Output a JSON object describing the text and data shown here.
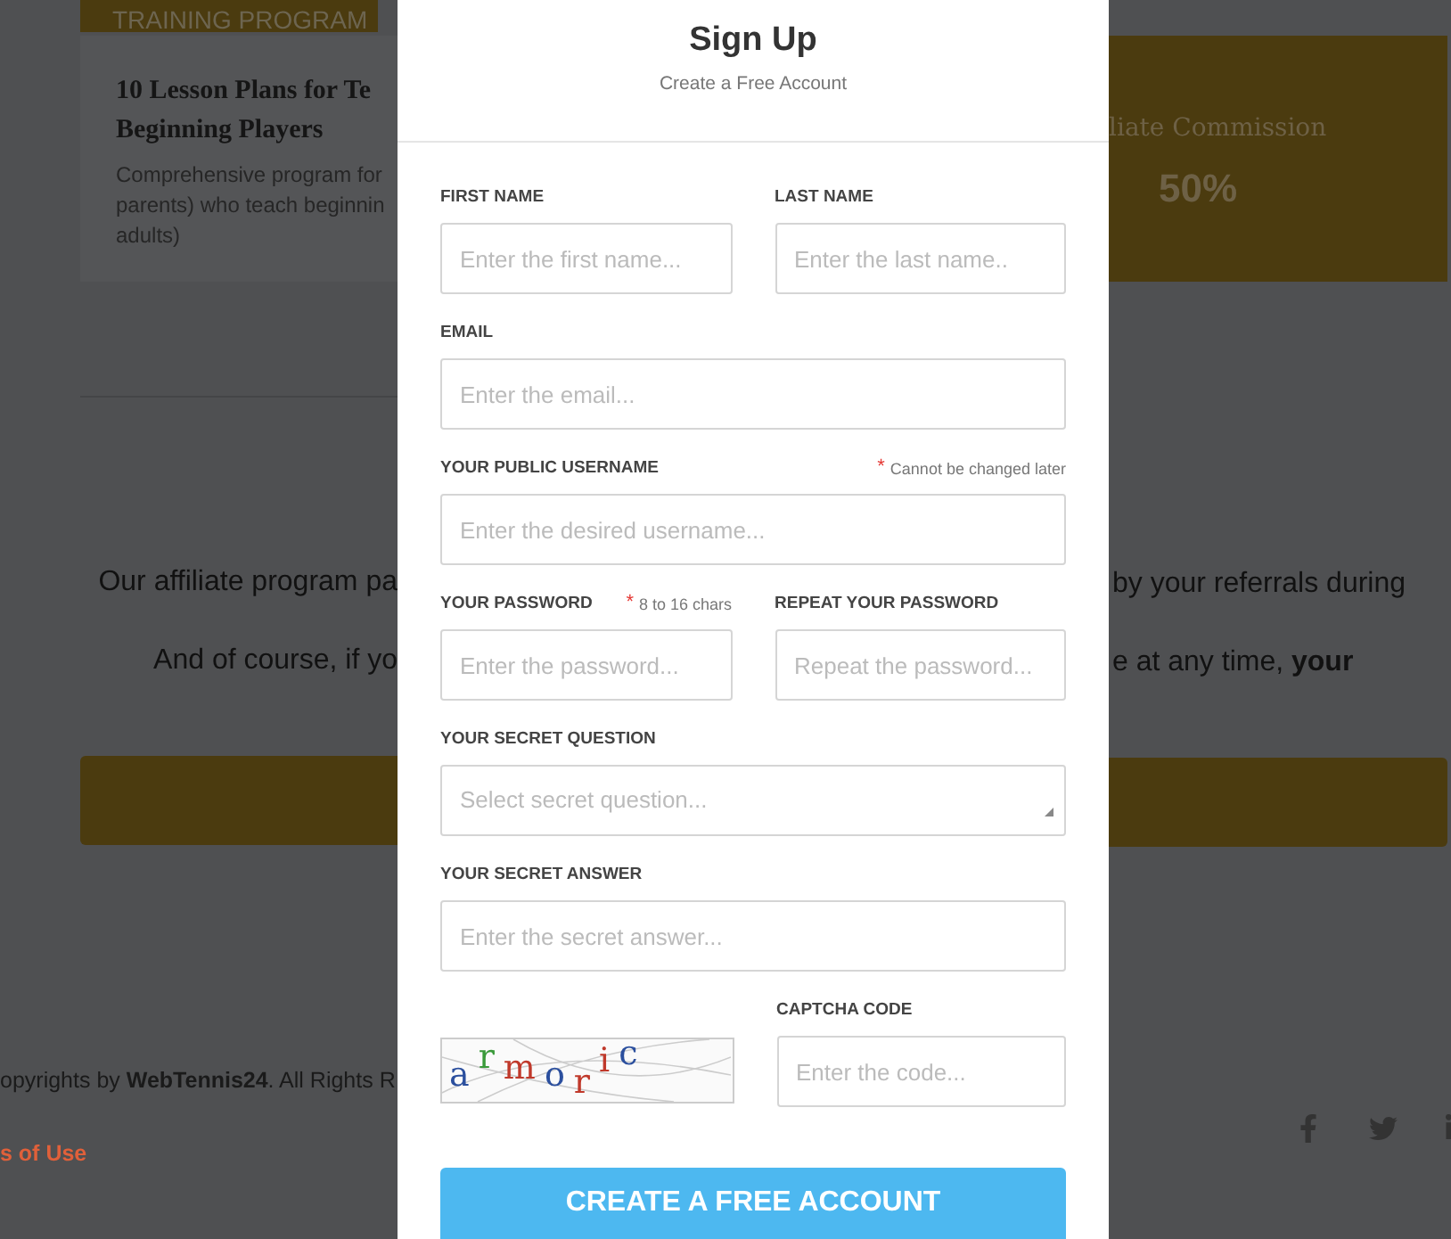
{
  "background": {
    "tag": "TRAINING PROGRAM",
    "card": {
      "title_lines": [
        "10 Lesson Plans for Te",
        "Beginning Players"
      ],
      "description_lines": [
        "Comprehensive program for",
        "parents) who teach beginnin",
        "adults)"
      ]
    },
    "commission": {
      "label": "liate Commission",
      "value": "50%"
    },
    "paragraphs": [
      {
        "left": "Our affiliate program pa",
        "right": "by your referrals during"
      },
      {
        "left": "And of course, if yo",
        "right": "e at any time, **your**"
      }
    ],
    "footer": {
      "copyright": "opyrights by **WebTennis24**. All Rights R",
      "link": "s of Use"
    },
    "social": [
      {
        "kind": "facebook"
      },
      {
        "kind": "twitter"
      },
      {
        "kind": "linkedin"
      }
    ]
  },
  "modal": {
    "title": "Sign Up",
    "subtitle": "Create a Free Account",
    "rows": [
      [
        {
          "kind": "text",
          "label": "FIRST NAME",
          "placeholder": "Enter the first name..."
        },
        {
          "kind": "text",
          "label": "LAST NAME",
          "placeholder": "Enter the last name.."
        }
      ],
      [
        {
          "kind": "text",
          "label": "EMAIL",
          "placeholder": "Enter the email..."
        }
      ],
      [
        {
          "kind": "text",
          "label": "YOUR PUBLIC USERNAME",
          "note_mark": "*",
          "note": "Cannot be changed later",
          "placeholder": "Enter the desired username..."
        }
      ],
      [
        {
          "kind": "text",
          "label": "YOUR PASSWORD",
          "note_mark": "*",
          "note": "8 to 16 chars",
          "placeholder": "Enter the password..."
        },
        {
          "kind": "text",
          "label": "REPEAT YOUR PASSWORD",
          "placeholder": "Repeat the password..."
        }
      ],
      [
        {
          "kind": "select",
          "label": "YOUR SECRET QUESTION",
          "placeholder": "Select secret question..."
        }
      ],
      [
        {
          "kind": "text",
          "label": "YOUR SECRET ANSWER",
          "placeholder": "Enter the secret answer..."
        }
      ]
    ],
    "captcha": {
      "letters": [
        {
          "char": "a",
          "color": "#2b4f9e"
        },
        {
          "char": "r",
          "color": "#3a9a3a"
        },
        {
          "char": "m",
          "color": "#c0392b"
        },
        {
          "char": "o",
          "color": "#2b4f9e"
        },
        {
          "char": "r",
          "color": "#c0392b"
        },
        {
          "char": "i",
          "color": "#c0392b"
        },
        {
          "char": "c",
          "color": "#2b4f9e"
        }
      ],
      "label": "CAPTCHA CODE",
      "placeholder": "Enter the code..."
    },
    "submit": "CREATE A FREE ACCOUNT"
  }
}
